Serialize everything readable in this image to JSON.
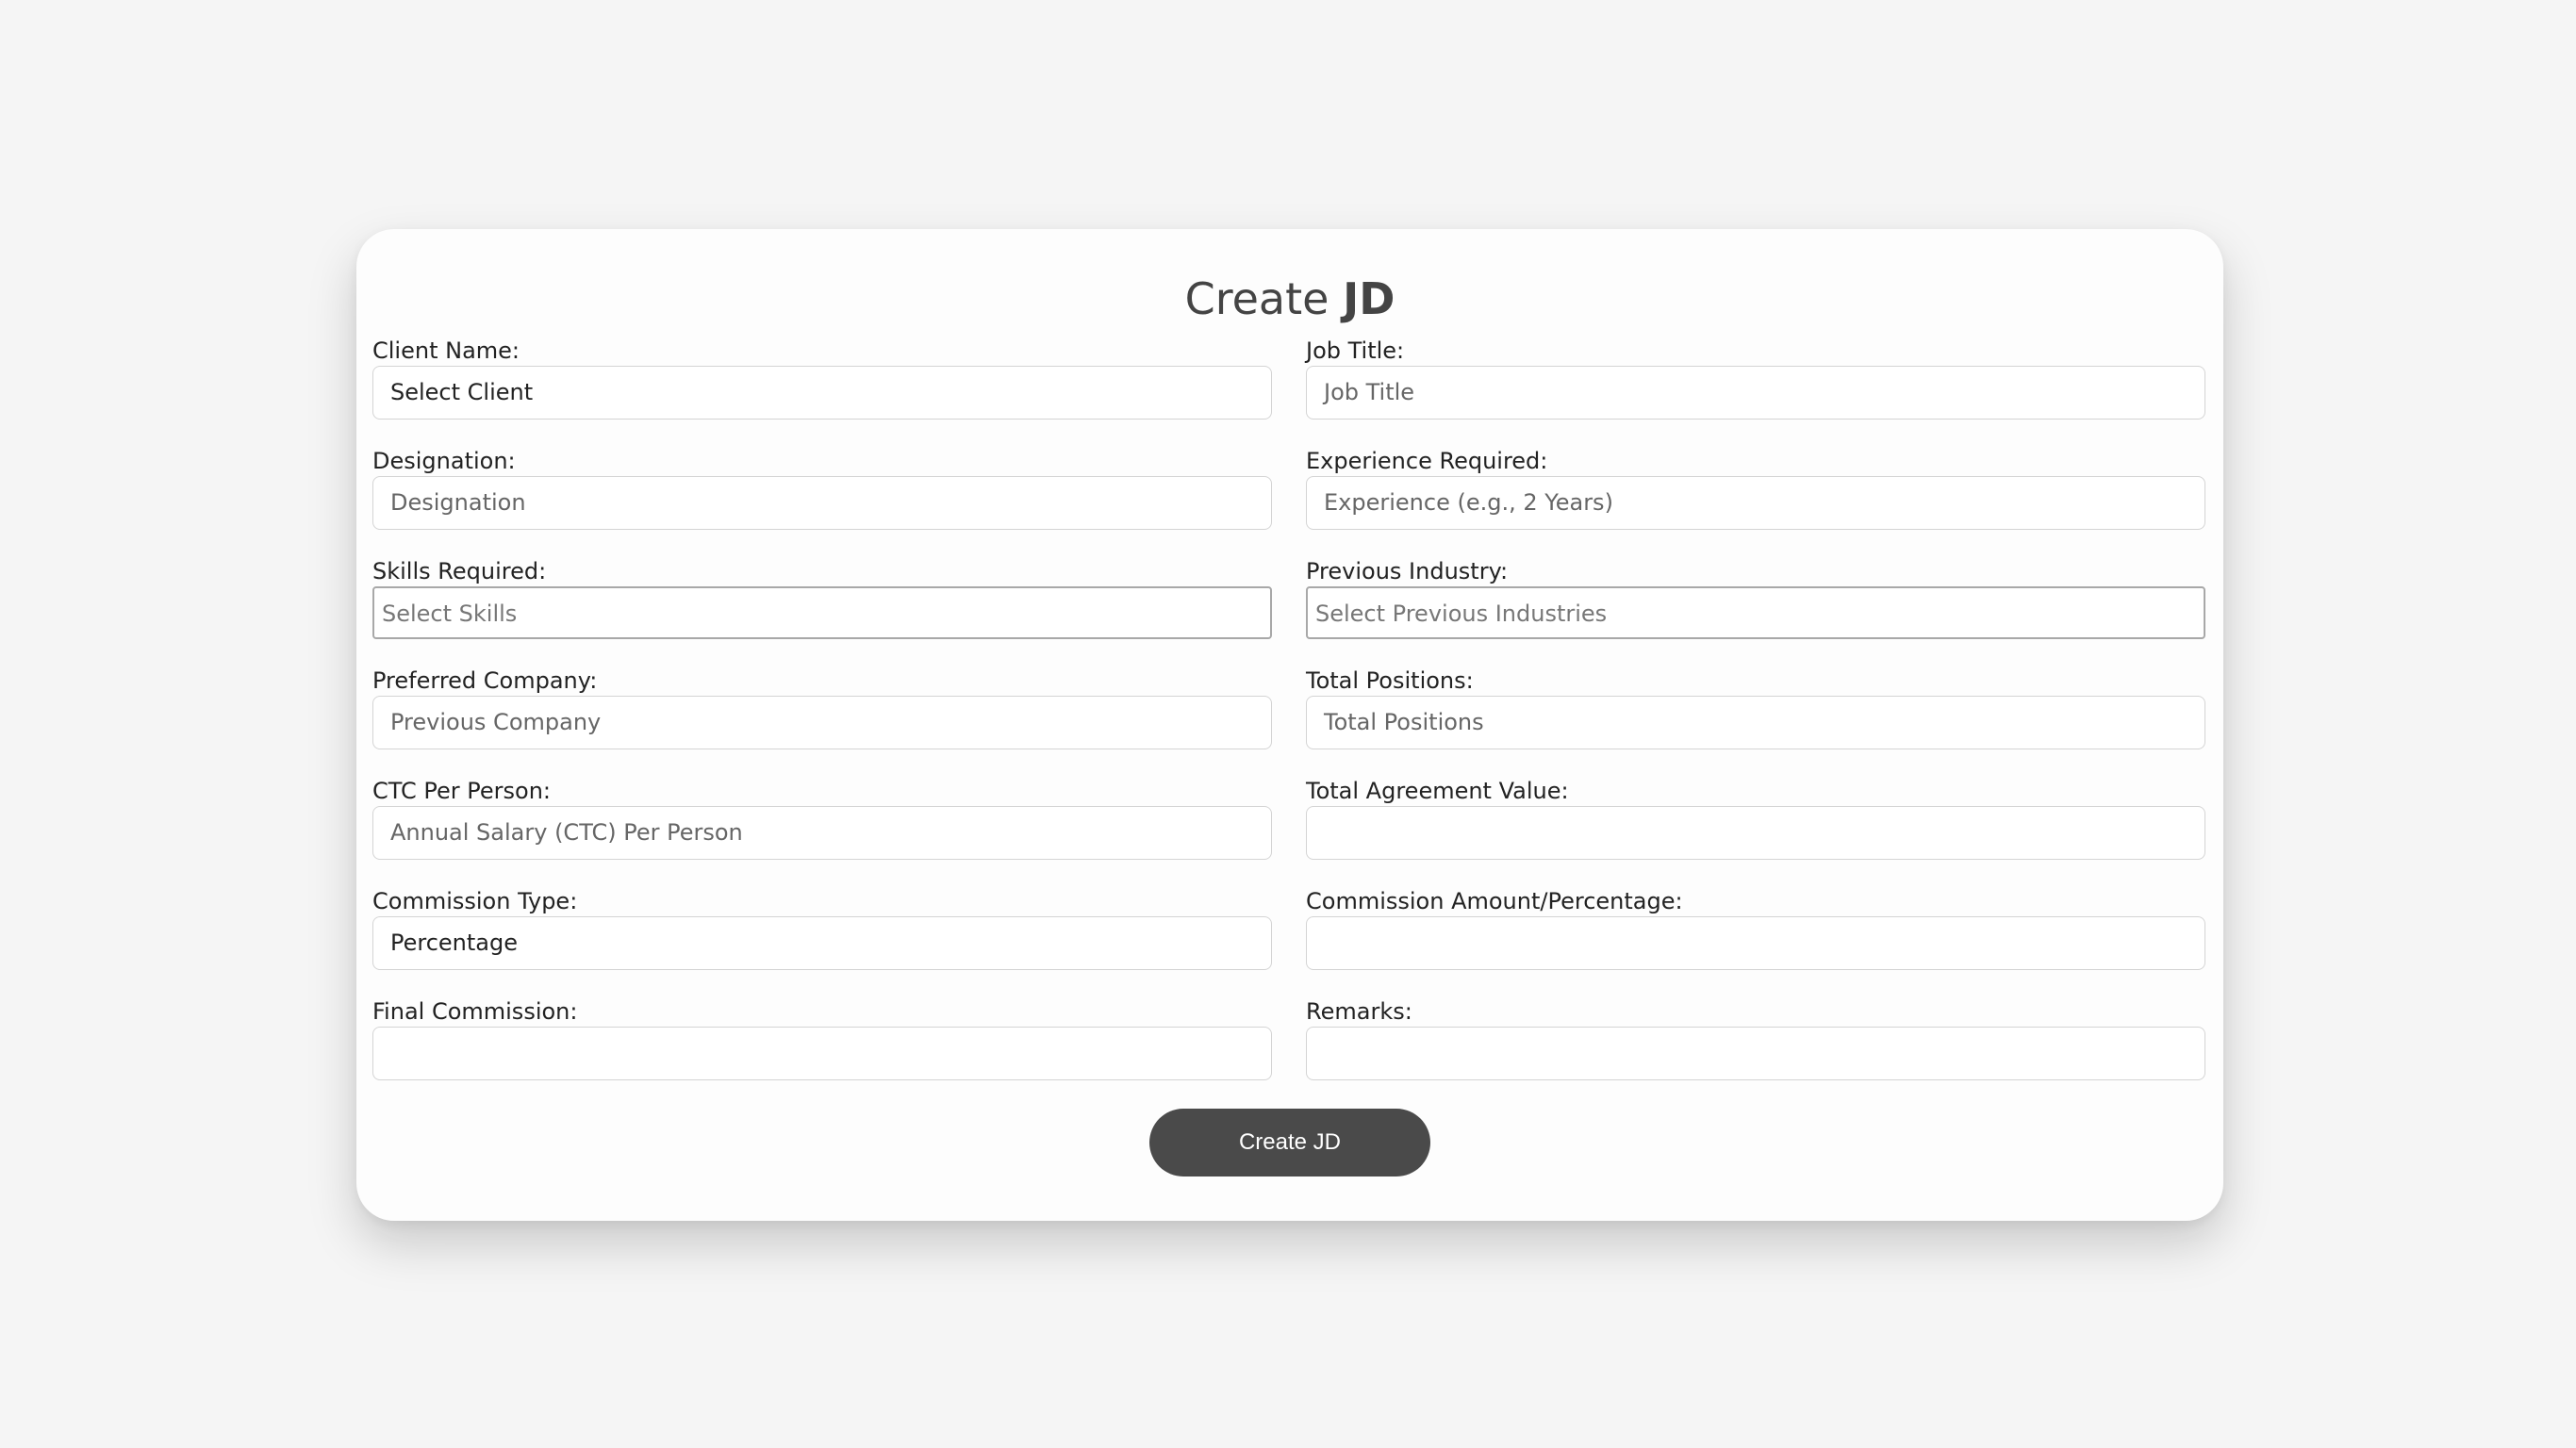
{
  "form": {
    "title_part1": "Create ",
    "title_part2": "JD",
    "fields": {
      "client_name": {
        "label": "Client Name:",
        "value": "Select Client"
      },
      "job_title": {
        "label": "Job Title:",
        "placeholder": "Job Title"
      },
      "designation": {
        "label": "Designation:",
        "placeholder": "Designation"
      },
      "experience": {
        "label": "Experience Required:",
        "placeholder": "Experience (e.g., 2 Years)"
      },
      "skills": {
        "label": "Skills Required:",
        "placeholder": "Select Skills"
      },
      "previous_industry": {
        "label": "Previous Industry:",
        "placeholder": "Select Previous Industries"
      },
      "preferred_company": {
        "label": "Preferred Company:",
        "placeholder": "Previous Company"
      },
      "total_positions": {
        "label": "Total Positions:",
        "placeholder": "Total Positions"
      },
      "ctc": {
        "label": "CTC Per Person:",
        "placeholder": "Annual Salary (CTC) Per Person"
      },
      "total_agreement": {
        "label": "Total Agreement Value:",
        "value": ""
      },
      "commission_type": {
        "label": "Commission Type:",
        "value": "Percentage"
      },
      "commission_amount": {
        "label": "Commission Amount/Percentage:",
        "value": ""
      },
      "final_commission": {
        "label": "Final Commission:",
        "value": ""
      },
      "remarks": {
        "label": "Remarks:",
        "value": ""
      }
    },
    "submit_label": "Create JD"
  }
}
